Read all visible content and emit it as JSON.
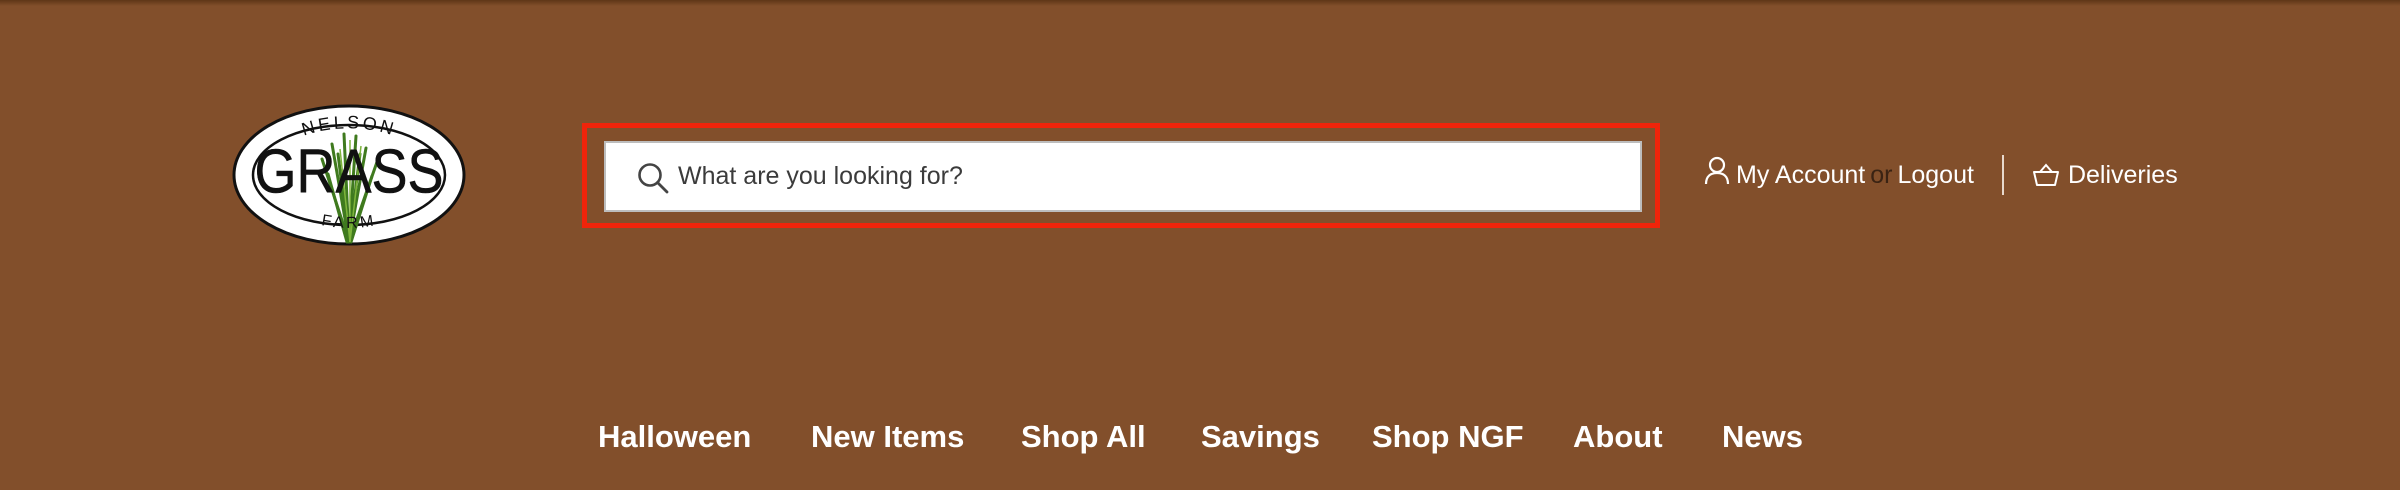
{
  "logo": {
    "arc_top": "NELSON",
    "center": "GRASS",
    "arc_bottom": "FARM"
  },
  "search": {
    "placeholder": "What are you looking for?",
    "icon": "search-icon"
  },
  "account": {
    "user_icon": "user-icon",
    "my_account_label": "My Account",
    "or_label": "or",
    "logout_label": "Logout",
    "basket_icon": "basket-icon",
    "deliveries_label": "Deliveries"
  },
  "nav": {
    "items": [
      {
        "label": "Halloween"
      },
      {
        "label": "New Items"
      },
      {
        "label": "Shop All"
      },
      {
        "label": "Savings"
      },
      {
        "label": "Shop NGF"
      },
      {
        "label": "About"
      },
      {
        "label": "News"
      }
    ]
  },
  "colors": {
    "header_bg": "#824f2b",
    "highlight": "#f0240a",
    "text": "#ffffff"
  }
}
